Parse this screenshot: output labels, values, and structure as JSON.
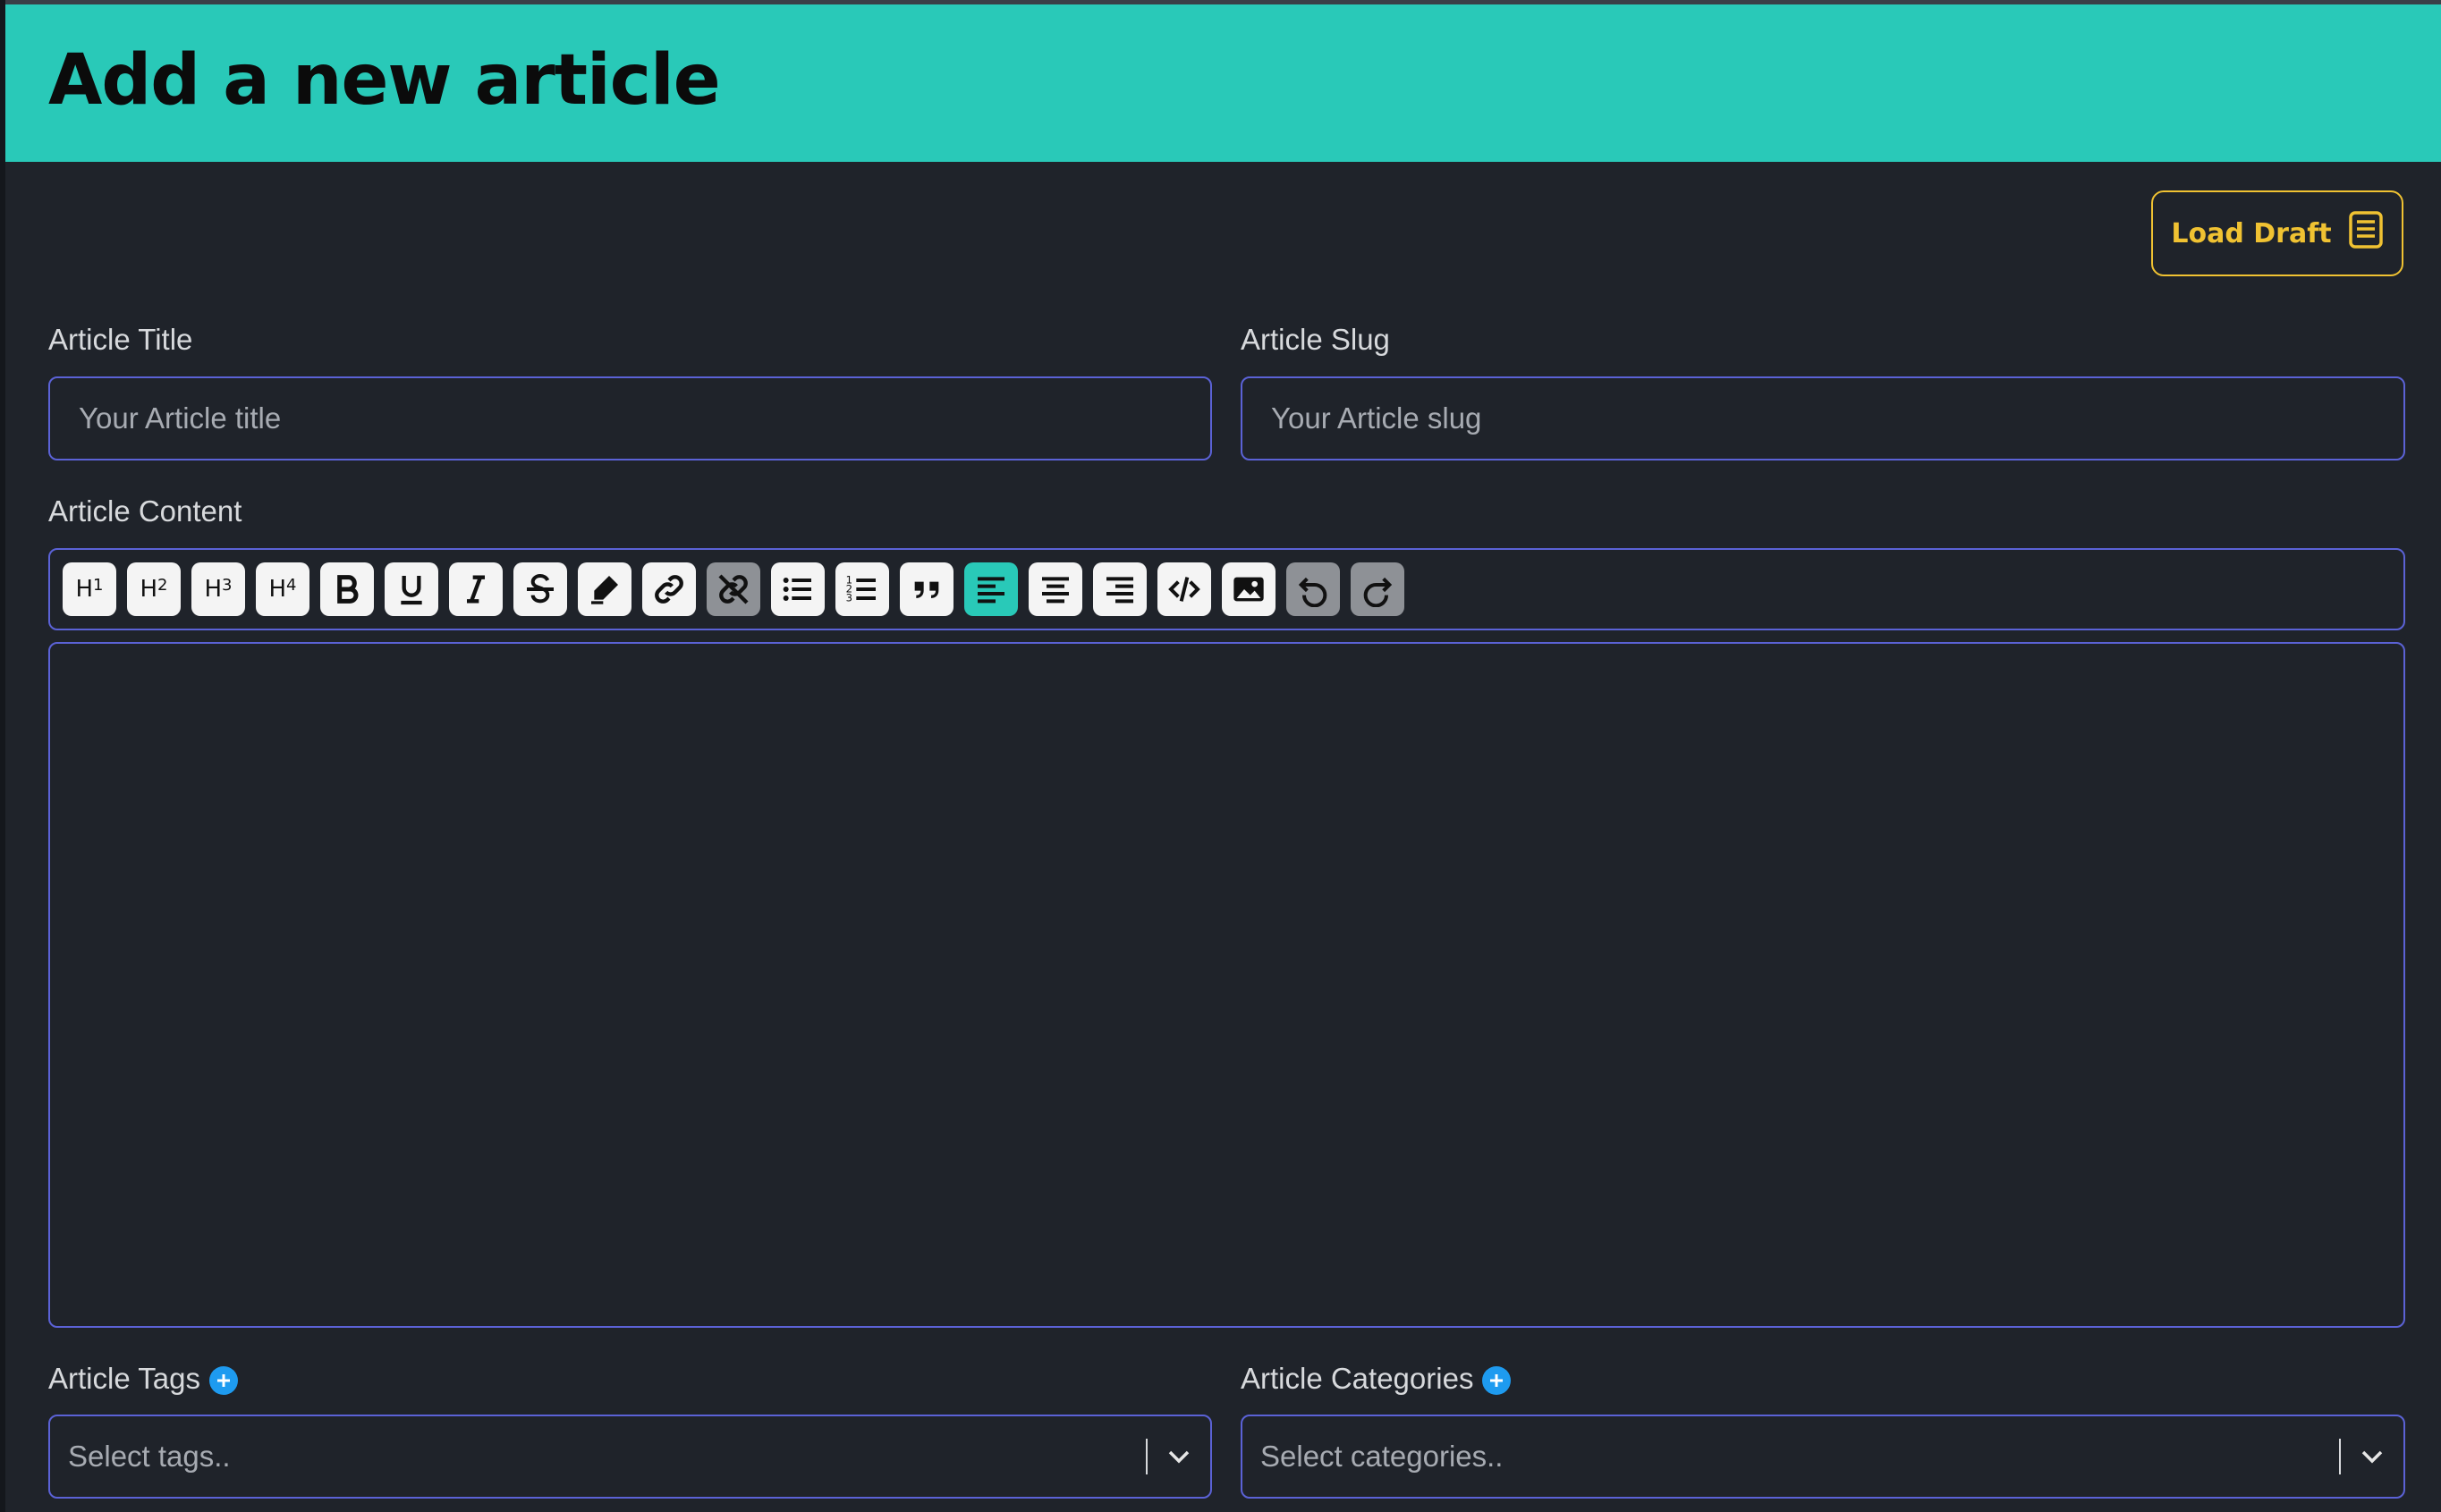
{
  "header": {
    "title": "Add a new article"
  },
  "load_draft": {
    "label": "Load Draft"
  },
  "title_field": {
    "label": "Article Title",
    "placeholder": "Your Article title"
  },
  "slug_field": {
    "label": "Article Slug",
    "placeholder": "Your Article slug"
  },
  "content": {
    "label": "Article Content",
    "toolbar": [
      {
        "id": "h1",
        "icon": "heading-1-icon",
        "text": "H",
        "sub": "1"
      },
      {
        "id": "h2",
        "icon": "heading-2-icon",
        "text": "H",
        "sub": "2"
      },
      {
        "id": "h3",
        "icon": "heading-3-icon",
        "text": "H",
        "sub": "3"
      },
      {
        "id": "h4",
        "icon": "heading-4-icon",
        "text": "H",
        "sub": "4"
      },
      {
        "id": "bold",
        "icon": "bold-icon"
      },
      {
        "id": "underline",
        "icon": "underline-icon"
      },
      {
        "id": "italic",
        "icon": "italic-icon"
      },
      {
        "id": "strike",
        "icon": "strikethrough-icon"
      },
      {
        "id": "highlight",
        "icon": "highlighter-icon"
      },
      {
        "id": "link",
        "icon": "link-icon"
      },
      {
        "id": "unlink",
        "icon": "unlink-icon",
        "state": "disabled"
      },
      {
        "id": "bullet-list",
        "icon": "bullet-list-icon"
      },
      {
        "id": "ordered-list",
        "icon": "ordered-list-icon"
      },
      {
        "id": "blockquote",
        "icon": "quote-icon"
      },
      {
        "id": "align-left",
        "icon": "align-left-icon",
        "state": "active"
      },
      {
        "id": "align-center",
        "icon": "align-center-icon"
      },
      {
        "id": "align-right",
        "icon": "align-right-icon"
      },
      {
        "id": "code",
        "icon": "code-icon"
      },
      {
        "id": "image",
        "icon": "image-icon"
      },
      {
        "id": "undo",
        "icon": "undo-icon",
        "state": "disabled"
      },
      {
        "id": "redo",
        "icon": "redo-icon",
        "state": "disabled"
      }
    ]
  },
  "tags": {
    "label": "Article Tags",
    "placeholder": "Select tags.."
  },
  "categories": {
    "label": "Article Categories",
    "placeholder": "Select categories.."
  },
  "colors": {
    "accent": "#29c9b8",
    "draft": "#f0c232",
    "border": "#5b62d6",
    "background": "#1f232a",
    "add": "#1e9bf0"
  }
}
